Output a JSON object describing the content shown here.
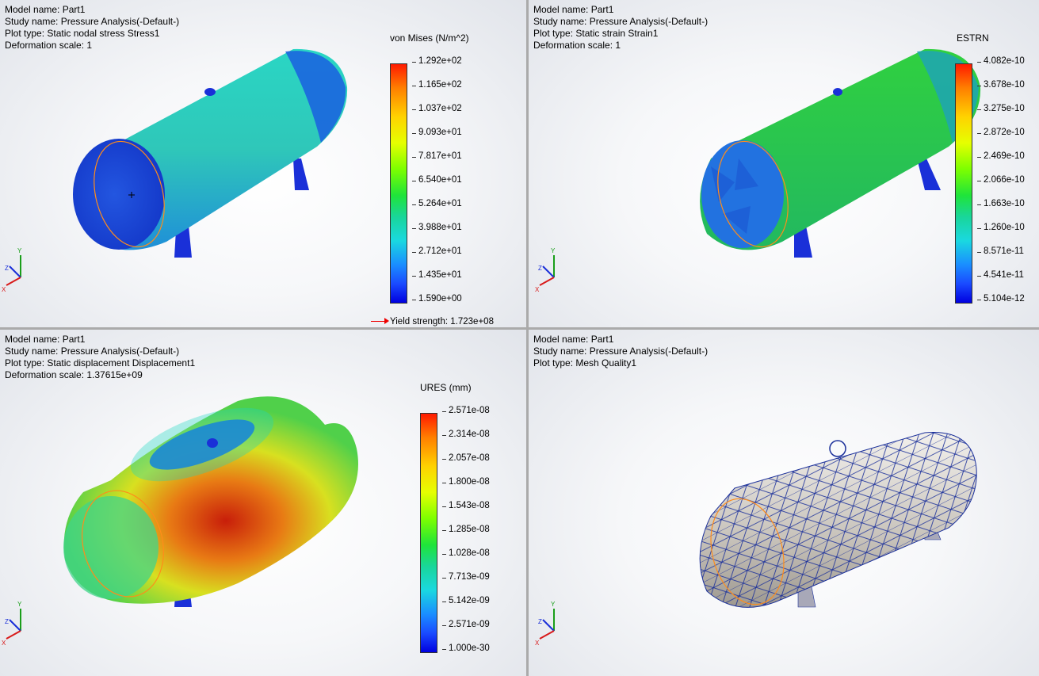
{
  "viewports": {
    "stress": {
      "info": [
        "Model name: Part1",
        "Study name: Pressure Analysis(-Default-)",
        "Plot type: Static nodal stress Stress1",
        "Deformation scale: 1"
      ],
      "legend_title": "von Mises (N/m^2)",
      "ticks": [
        "1.292e+02",
        "1.165e+02",
        "1.037e+02",
        "9.093e+01",
        "7.817e+01",
        "6.540e+01",
        "5.264e+01",
        "3.988e+01",
        "2.712e+01",
        "1.435e+01",
        "1.590e+00"
      ],
      "yield": "Yield strength: 1.723e+08"
    },
    "strain": {
      "info": [
        "Model name: Part1",
        "Study name: Pressure Analysis(-Default-)",
        "Plot type: Static strain Strain1",
        "Deformation scale: 1"
      ],
      "legend_title": "ESTRN",
      "ticks": [
        "4.082e-10",
        "3.678e-10",
        "3.275e-10",
        "2.872e-10",
        "2.469e-10",
        "2.066e-10",
        "1.663e-10",
        "1.260e-10",
        "8.571e-11",
        "4.541e-11",
        "5.104e-12"
      ]
    },
    "displacement": {
      "info": [
        "Model name: Part1",
        "Study name: Pressure Analysis(-Default-)",
        "Plot type: Static displacement Displacement1",
        "Deformation scale: 1.37615e+09"
      ],
      "legend_title": "URES (mm)",
      "ticks": [
        "2.571e-08",
        "2.314e-08",
        "2.057e-08",
        "1.800e-08",
        "1.543e-08",
        "1.285e-08",
        "1.028e-08",
        "7.713e-09",
        "5.142e-09",
        "2.571e-09",
        "1.000e-30"
      ]
    },
    "mesh": {
      "info": [
        "Model name: Part1",
        "Study name: Pressure Analysis(-Default-)",
        "Plot type: Mesh Quality1"
      ]
    }
  },
  "triad": {
    "x": "X",
    "y": "Y",
    "z": "Z"
  },
  "colors": {
    "accent_edge": "#ff8c1a",
    "yield_arrow": "#e00000",
    "mesh_line": "#1a2f9a"
  }
}
